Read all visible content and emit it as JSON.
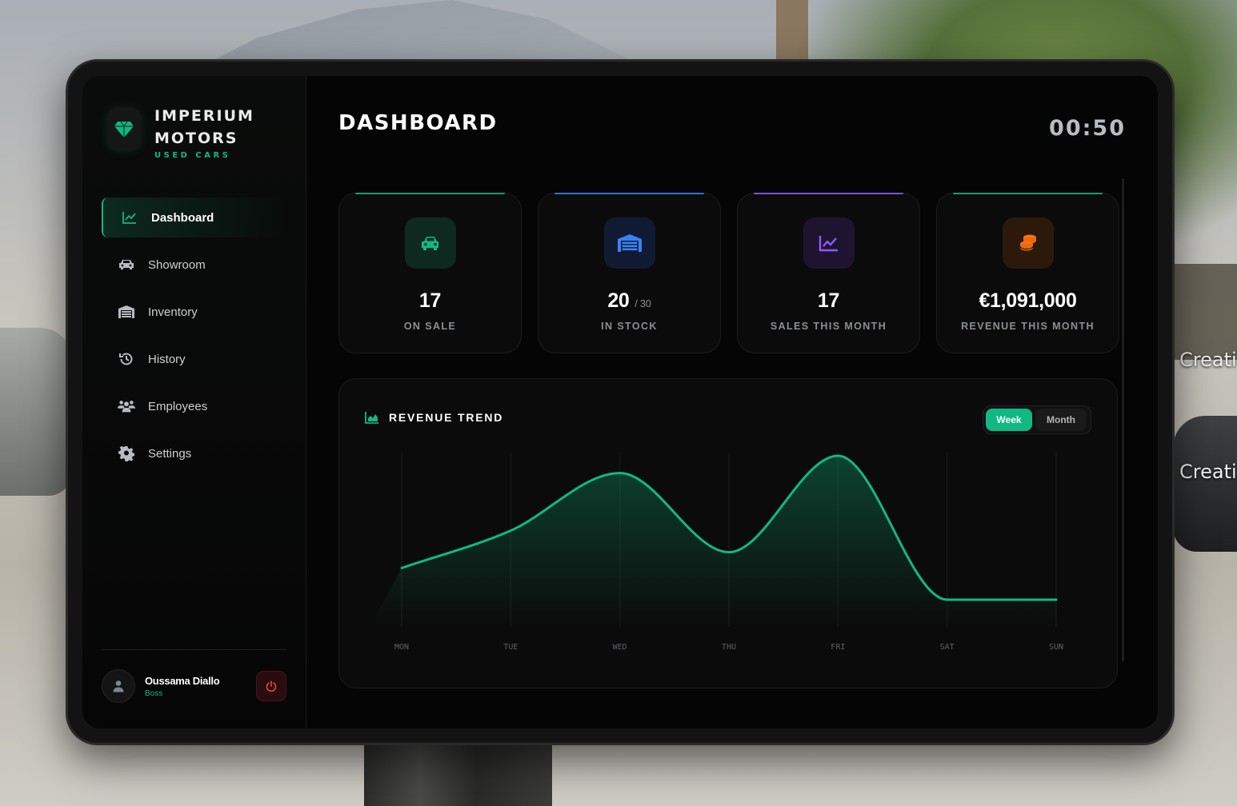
{
  "background": {
    "overlay_texts": [
      "Creati",
      "Creati"
    ]
  },
  "sidebar": {
    "brand": {
      "title_line1": "IMPERIUM",
      "title_line2": "MOTORS",
      "subtitle": "USED CARS",
      "icon": "diamond-icon"
    },
    "items": [
      {
        "label": "Dashboard",
        "icon": "chart-line-icon",
        "active": true
      },
      {
        "label": "Showroom",
        "icon": "car-icon",
        "active": false
      },
      {
        "label": "Inventory",
        "icon": "warehouse-icon",
        "active": false
      },
      {
        "label": "History",
        "icon": "history-icon",
        "active": false
      },
      {
        "label": "Employees",
        "icon": "users-icon",
        "active": false
      },
      {
        "label": "Settings",
        "icon": "gear-icon",
        "active": false
      }
    ],
    "user": {
      "name": "Oussama Diallo",
      "role": "Boss"
    }
  },
  "header": {
    "title": "DASHBOARD",
    "clock": "00:50"
  },
  "stats": [
    {
      "value": "17",
      "sub": "",
      "label": "ON SALE",
      "icon": "car-icon",
      "accent": "#10b981"
    },
    {
      "value": "20",
      "sub": "/ 30",
      "label": "IN STOCK",
      "icon": "warehouse-icon",
      "accent": "#3b82f6"
    },
    {
      "value": "17",
      "sub": "",
      "label": "SALES THIS MONTH",
      "icon": "chart-line-icon",
      "accent": "#8b5cf6"
    },
    {
      "value": "€1,091,000",
      "sub": "",
      "label": "REVENUE THIS MONTH",
      "icon": "coins-icon",
      "accent": "#10b981"
    }
  ],
  "revenue": {
    "title": "REVENUE TREND",
    "toggle": {
      "week": "Week",
      "month": "Month",
      "selected": "week"
    }
  },
  "colors": {
    "accent": "#10b981",
    "danger": "#ef4444"
  },
  "chart_data": {
    "type": "area",
    "title": "REVENUE TREND",
    "categories": [
      "MON",
      "TUE",
      "WED",
      "THU",
      "FRI",
      "SAT",
      "SUN"
    ],
    "values": [
      0.22,
      0.48,
      0.88,
      0.33,
      1.0,
      0.0,
      0.0
    ],
    "ylim": [
      0,
      1
    ],
    "grid": "vertical",
    "y_axis_labels": "none",
    "color": "#10b981"
  }
}
